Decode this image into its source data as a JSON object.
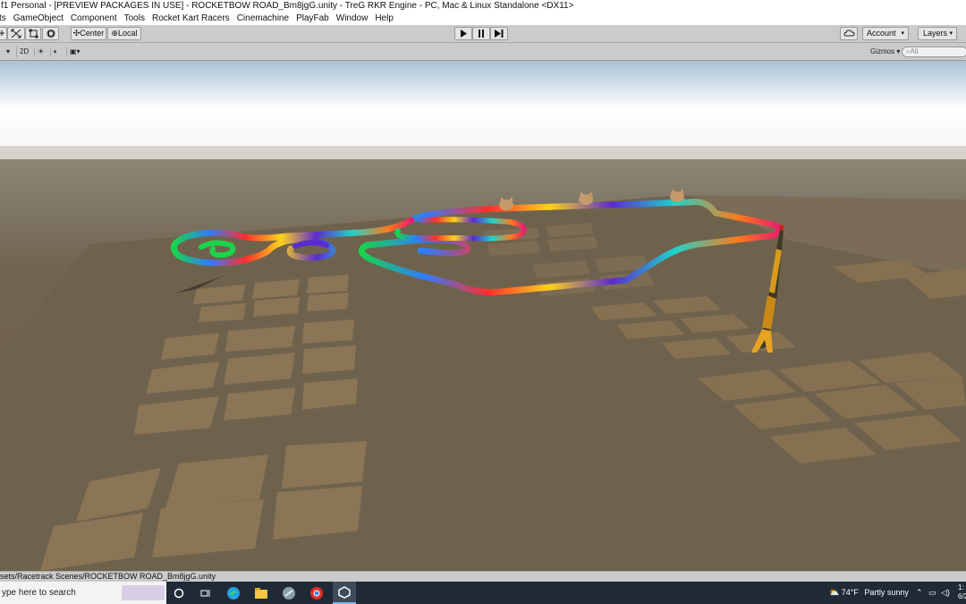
{
  "window": {
    "title": "f1 Personal - [PREVIEW PACKAGES IN USE] - ROCKETBOW ROAD_Bm8jgG.unity - TreG RKR Engine - PC, Mac & Linux Standalone <DX11>"
  },
  "menu": [
    "ts",
    "GameObject",
    "Component",
    "Tools",
    "Rocket Kart Racers",
    "Cinemachine",
    "PlayFab",
    "Window",
    "Help"
  ],
  "toolbar": {
    "center_label": "Center",
    "local_label": "Local",
    "account_label": "Account",
    "layers_label": "Layers"
  },
  "scene_toolbar": {
    "mode_2d": "2D",
    "gizmos_label": "Gizmos",
    "search_placeholder": "All"
  },
  "status": {
    "path": "sets/Racetrack Scenes/ROCKETBOW ROAD_Bm8jgG.unity"
  },
  "taskbar": {
    "search_placeholder": "ype here to search",
    "weather_temp": "74°F",
    "weather_text": "Partly sunny",
    "time": "1:",
    "date": "6/2"
  },
  "colors": {
    "accent": "#0078d7",
    "ground": "#6c5d47",
    "sky": "#ffffff"
  }
}
